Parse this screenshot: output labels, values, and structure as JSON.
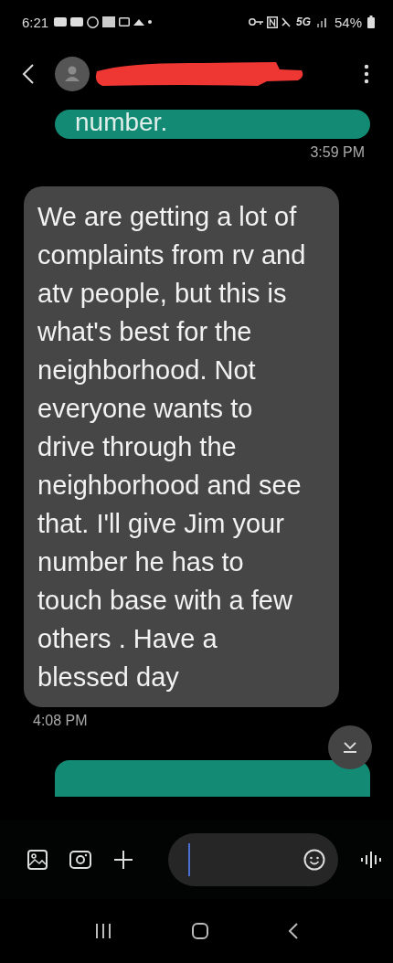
{
  "status_bar": {
    "time": "6:21",
    "network": "5G",
    "battery": "54%"
  },
  "header": {
    "contact_redacted": true
  },
  "messages": [
    {
      "kind": "sent",
      "text": "number.",
      "time": "3:59 PM"
    },
    {
      "kind": "received",
      "text": "We are getting a lot of complaints from rv and atv people, but this is what's best for the neighborhood. Not everyone wants to drive through the neighborhood and see that. I'll give Jim your number he has to touch base with a few others . Have a blessed day",
      "time": "4:08 PM"
    },
    {
      "kind": "sent_partial"
    }
  ]
}
